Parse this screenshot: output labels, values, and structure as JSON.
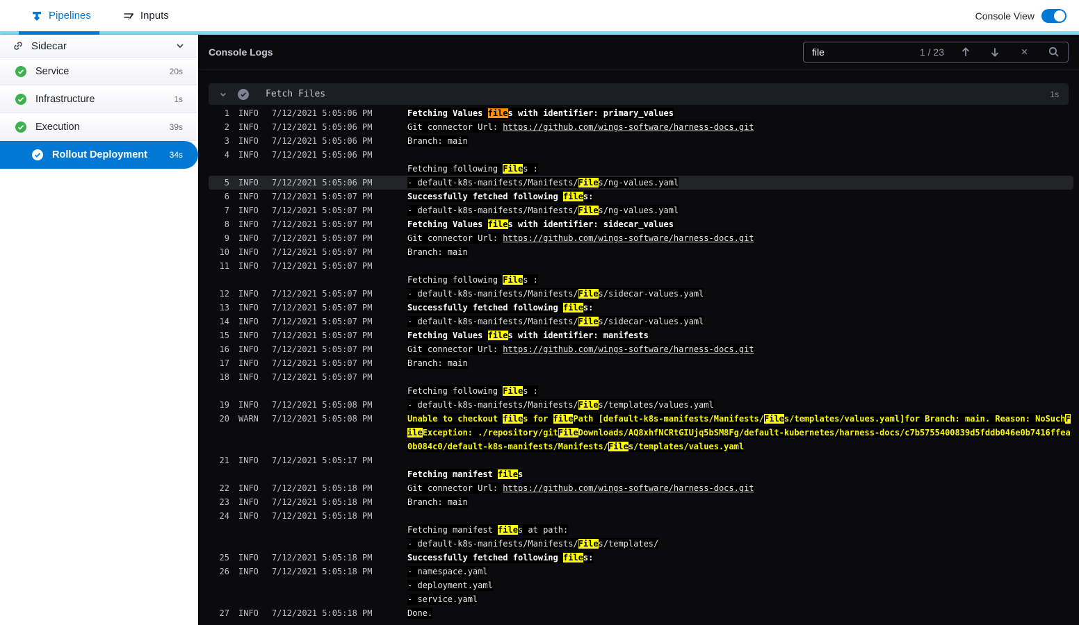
{
  "colors": {
    "brand_blue": "#0278d5",
    "accent_cyan": "#85d7f4",
    "success_green": "#3bb24f",
    "console_bg": "#0b0b0d",
    "match_highlight": "#ffff00",
    "active_match_highlight": "#ff9102",
    "warn_text": "#fafa00"
  },
  "topbar": {
    "tabs": [
      {
        "label": "Pipelines",
        "icon": "pipelines-icon",
        "active": true
      },
      {
        "label": "Inputs",
        "icon": "inputs-icon",
        "active": false
      }
    ],
    "console_view_label": "Console View",
    "console_view_on": true
  },
  "sidebar": {
    "group": {
      "label": "Sidecar",
      "icon": "link-icon",
      "chevron": "chevron-down-icon"
    },
    "items": [
      {
        "label": "Service",
        "duration": "20s",
        "status": "success"
      },
      {
        "label": "Infrastructure",
        "duration": "1s",
        "status": "success"
      },
      {
        "label": "Execution",
        "duration": "39s",
        "status": "success"
      },
      {
        "label": "Rollout Deployment",
        "duration": "34s",
        "status": "success",
        "selected": true
      }
    ]
  },
  "console": {
    "title": "Console Logs",
    "search": {
      "query": "file",
      "counter": "1 / 23"
    },
    "section": {
      "title": "Fetch Files",
      "duration": "1s"
    },
    "entries": [
      {
        "n": "1",
        "lvl": "INFO",
        "ts": "7/12/2021 5:05:06 PM",
        "lines": [
          [
            {
              "x": "Fetching Values ",
              "c": "b"
            },
            {
              "x": "file",
              "c": "a"
            },
            {
              "x": "s with identifier: primary_values",
              "c": "b"
            }
          ]
        ]
      },
      {
        "n": "2",
        "lvl": "INFO",
        "ts": "7/12/2021 5:05:06 PM",
        "lines": [
          [
            {
              "x": "Git connector Url: "
            },
            {
              "x": "https://github.com/wings-software/harness-docs.git",
              "c": "u"
            }
          ]
        ]
      },
      {
        "n": "3",
        "lvl": "INFO",
        "ts": "7/12/2021 5:05:06 PM",
        "lines": [
          [
            {
              "x": "Branch: main"
            }
          ]
        ]
      },
      {
        "n": "4",
        "lvl": "INFO",
        "ts": "7/12/2021 5:05:06 PM",
        "lines": [
          [],
          [
            {
              "x": "Fetching following "
            },
            {
              "x": "File",
              "c": "m"
            },
            {
              "x": "s :"
            }
          ]
        ]
      },
      {
        "n": "5",
        "lvl": "INFO",
        "ts": "7/12/2021 5:05:06 PM",
        "selected": true,
        "lines": [
          [
            {
              "x": "- default-k8s-manifests/Manifests/"
            },
            {
              "x": "File",
              "c": "m"
            },
            {
              "x": "s/ng-values.yaml"
            }
          ]
        ]
      },
      {
        "n": "6",
        "lvl": "INFO",
        "ts": "7/12/2021 5:05:07 PM",
        "lines": [
          [
            {
              "x": "Successfully fetched following ",
              "c": "b"
            },
            {
              "x": "file",
              "c": "m"
            },
            {
              "x": "s:",
              "c": "b"
            }
          ]
        ]
      },
      {
        "n": "7",
        "lvl": "INFO",
        "ts": "7/12/2021 5:05:07 PM",
        "lines": [
          [
            {
              "x": "- default-k8s-manifests/Manifests/"
            },
            {
              "x": "File",
              "c": "m"
            },
            {
              "x": "s/ng-values.yaml"
            }
          ]
        ]
      },
      {
        "n": "8",
        "lvl": "INFO",
        "ts": "7/12/2021 5:05:07 PM",
        "lines": [
          [
            {
              "x": "Fetching Values ",
              "c": "b"
            },
            {
              "x": "file",
              "c": "m"
            },
            {
              "x": "s with identifier: sidecar_values",
              "c": "b"
            }
          ]
        ]
      },
      {
        "n": "9",
        "lvl": "INFO",
        "ts": "7/12/2021 5:05:07 PM",
        "lines": [
          [
            {
              "x": "Git connector Url: "
            },
            {
              "x": "https://github.com/wings-software/harness-docs.git",
              "c": "u"
            }
          ]
        ]
      },
      {
        "n": "10",
        "lvl": "INFO",
        "ts": "7/12/2021 5:05:07 PM",
        "lines": [
          [
            {
              "x": "Branch: main"
            }
          ]
        ]
      },
      {
        "n": "11",
        "lvl": "INFO",
        "ts": "7/12/2021 5:05:07 PM",
        "lines": [
          [],
          [
            {
              "x": "Fetching following "
            },
            {
              "x": "File",
              "c": "m"
            },
            {
              "x": "s :"
            }
          ]
        ]
      },
      {
        "n": "12",
        "lvl": "INFO",
        "ts": "7/12/2021 5:05:07 PM",
        "lines": [
          [
            {
              "x": "- default-k8s-manifests/Manifests/"
            },
            {
              "x": "File",
              "c": "m"
            },
            {
              "x": "s/sidecar-values.yaml"
            }
          ]
        ]
      },
      {
        "n": "13",
        "lvl": "INFO",
        "ts": "7/12/2021 5:05:07 PM",
        "lines": [
          [
            {
              "x": "Successfully fetched following ",
              "c": "b"
            },
            {
              "x": "file",
              "c": "m"
            },
            {
              "x": "s:",
              "c": "b"
            }
          ]
        ]
      },
      {
        "n": "14",
        "lvl": "INFO",
        "ts": "7/12/2021 5:05:07 PM",
        "lines": [
          [
            {
              "x": "- default-k8s-manifests/Manifests/"
            },
            {
              "x": "File",
              "c": "m"
            },
            {
              "x": "s/sidecar-values.yaml"
            }
          ]
        ]
      },
      {
        "n": "15",
        "lvl": "INFO",
        "ts": "7/12/2021 5:05:07 PM",
        "lines": [
          [
            {
              "x": "Fetching Values ",
              "c": "b"
            },
            {
              "x": "file",
              "c": "m"
            },
            {
              "x": "s with identifier: manifests",
              "c": "b"
            }
          ]
        ]
      },
      {
        "n": "16",
        "lvl": "INFO",
        "ts": "7/12/2021 5:05:07 PM",
        "lines": [
          [
            {
              "x": "Git connector Url: "
            },
            {
              "x": "https://github.com/wings-software/harness-docs.git",
              "c": "u"
            }
          ]
        ]
      },
      {
        "n": "17",
        "lvl": "INFO",
        "ts": "7/12/2021 5:05:07 PM",
        "lines": [
          [
            {
              "x": "Branch: main"
            }
          ]
        ]
      },
      {
        "n": "18",
        "lvl": "INFO",
        "ts": "7/12/2021 5:05:07 PM",
        "lines": [
          [],
          [
            {
              "x": "Fetching following "
            },
            {
              "x": "File",
              "c": "m"
            },
            {
              "x": "s :"
            }
          ]
        ]
      },
      {
        "n": "19",
        "lvl": "INFO",
        "ts": "7/12/2021 5:05:08 PM",
        "lines": [
          [
            {
              "x": "- default-k8s-manifests/Manifests/"
            },
            {
              "x": "File",
              "c": "m"
            },
            {
              "x": "s/templates/values.yaml"
            }
          ]
        ]
      },
      {
        "n": "20",
        "lvl": "WARN",
        "ts": "7/12/2021 5:05:08 PM",
        "lines": [
          [
            {
              "x": "Unable to checkout ",
              "c": "w"
            },
            {
              "x": "file",
              "c": "m"
            },
            {
              "x": "s for ",
              "c": "w"
            },
            {
              "x": "file",
              "c": "m"
            },
            {
              "x": "Path [default-k8s-manifests/Manifests/",
              "c": "w"
            },
            {
              "x": "File",
              "c": "m"
            },
            {
              "x": "s/templates/values.yaml]for Branch: main. Reason: NoSuch",
              "c": "w"
            },
            {
              "x": "F",
              "c": "m"
            }
          ],
          [
            {
              "x": "ile",
              "c": "m"
            },
            {
              "x": "Exception: ./repository/git",
              "c": "w"
            },
            {
              "x": "File",
              "c": "m"
            },
            {
              "x": "Downloads/AQ8xhfNCRtGIUjq5bSM8Fg/default-kubernetes/harness-docs/c7b5755400839d5fddb046e0b7416ffea",
              "c": "w"
            }
          ],
          [
            {
              "x": "0b084c0/default-k8s-manifests/Manifests/",
              "c": "w"
            },
            {
              "x": "File",
              "c": "m"
            },
            {
              "x": "s/templates/values.yaml",
              "c": "w"
            }
          ]
        ]
      },
      {
        "n": "21",
        "lvl": "INFO",
        "ts": "7/12/2021 5:05:17 PM",
        "lines": [
          [],
          [
            {
              "x": "Fetching manifest ",
              "c": "b"
            },
            {
              "x": "file",
              "c": "m"
            },
            {
              "x": "s",
              "c": "b"
            }
          ]
        ]
      },
      {
        "n": "22",
        "lvl": "INFO",
        "ts": "7/12/2021 5:05:18 PM",
        "lines": [
          [
            {
              "x": "Git connector Url: "
            },
            {
              "x": "https://github.com/wings-software/harness-docs.git",
              "c": "u"
            }
          ]
        ]
      },
      {
        "n": "23",
        "lvl": "INFO",
        "ts": "7/12/2021 5:05:18 PM",
        "lines": [
          [
            {
              "x": "Branch: main"
            }
          ]
        ]
      },
      {
        "n": "24",
        "lvl": "INFO",
        "ts": "7/12/2021 5:05:18 PM",
        "lines": [
          [],
          [
            {
              "x": "Fetching manifest "
            },
            {
              "x": "file",
              "c": "m"
            },
            {
              "x": "s at path:"
            }
          ],
          [
            {
              "x": "- default-k8s-manifests/Manifests/"
            },
            {
              "x": "File",
              "c": "m"
            },
            {
              "x": "s/templates/"
            }
          ]
        ]
      },
      {
        "n": "25",
        "lvl": "INFO",
        "ts": "7/12/2021 5:05:18 PM",
        "lines": [
          [
            {
              "x": "Successfully fetched following ",
              "c": "b"
            },
            {
              "x": "file",
              "c": "m"
            },
            {
              "x": "s:",
              "c": "b"
            }
          ]
        ]
      },
      {
        "n": "26",
        "lvl": "INFO",
        "ts": "7/12/2021 5:05:18 PM",
        "lines": [
          [
            {
              "x": "- namespace.yaml"
            }
          ],
          [
            {
              "x": "- deployment.yaml"
            }
          ],
          [
            {
              "x": "- service.yaml"
            }
          ]
        ]
      },
      {
        "n": "27",
        "lvl": "INFO",
        "ts": "7/12/2021 5:05:18 PM",
        "lines": [
          [
            {
              "x": "Done."
            }
          ]
        ]
      }
    ]
  }
}
